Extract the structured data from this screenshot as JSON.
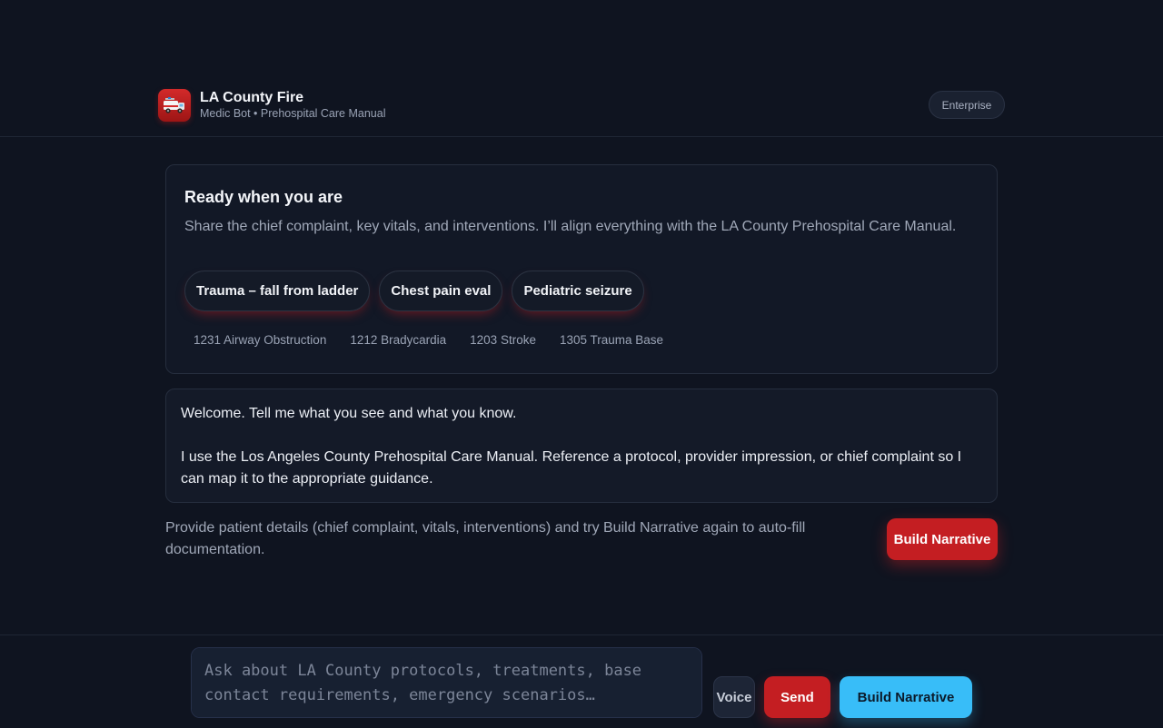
{
  "header": {
    "title": "LA County Fire",
    "subtitle": "Medic Bot • Prehospital Care Manual",
    "logo_icon": "fire-truck-icon",
    "badge": "Enterprise"
  },
  "ready": {
    "title": "Ready when you are",
    "description": "Share the chief complaint, key vitals, and interventions. I’ll align everything with the LA County Prehospital Care Manual.",
    "chips": [
      "Trauma – fall from ladder",
      "Chest pain eval",
      "Pediatric seizure"
    ],
    "protocols": [
      "1231 Airway Obstruction",
      "1212 Bradycardia",
      "1203 Stroke",
      "1305 Trauma Base"
    ]
  },
  "message": {
    "line1": "Welcome. Tell me what you see and what you know.",
    "line2": "I use the Los Angeles County Prehospital Care Manual. Reference a protocol, provider impression, or chief complaint so I can map it to the appropriate guidance."
  },
  "hint": {
    "text": "Provide patient details (chief complaint, vitals, interventions) and try Build Narrative again to auto-fill documentation.",
    "button": "Build Narrative"
  },
  "composer": {
    "placeholder": "Ask about LA County protocols, treatments, base contact requirements, emergency scenarios…",
    "voice_label": "Voice",
    "send_label": "Send",
    "narrative_label": "Build Narrative"
  },
  "colors": {
    "background": "#0f1420",
    "accent_red": "#c41e22",
    "accent_blue": "#38bdf8"
  }
}
